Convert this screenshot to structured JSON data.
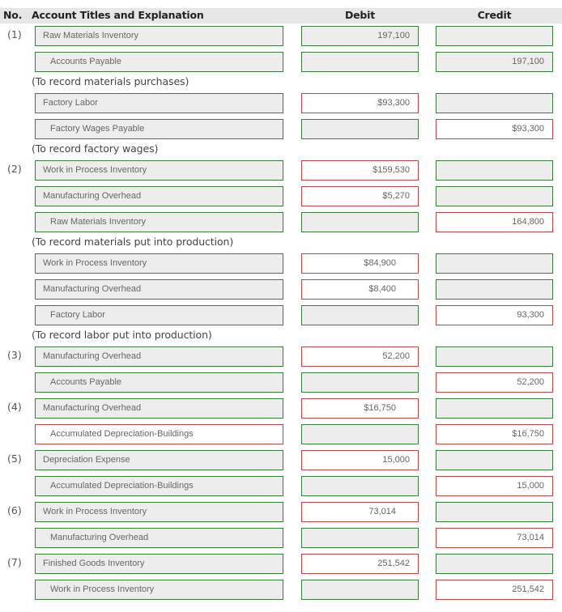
{
  "header": {
    "no": "No.",
    "account": "Account Titles and Explanation",
    "debit": "Debit",
    "credit": "Credit"
  },
  "status_colors": {
    "correct": "#3f7a3f",
    "incorrect": "#b04a4a"
  },
  "rows": [
    {
      "type": "line",
      "no": "(1)",
      "account": "Raw Materials Inventory",
      "indent": false,
      "account_status": "correct",
      "debit": "197,100",
      "debit_status": "correct",
      "credit": "",
      "credit_status": "correct"
    },
    {
      "type": "line",
      "no": "",
      "account": "Accounts Payable",
      "indent": true,
      "account_status": "correct",
      "debit": "",
      "debit_status": "correct",
      "credit": "197,100",
      "credit_status": "correct"
    },
    {
      "type": "explanation",
      "text": "(To record materials purchases)"
    },
    {
      "type": "line",
      "no": "",
      "account": "Factory Labor",
      "indent": false,
      "account_status": "correct",
      "debit": "$93,300",
      "debit_status": "incorrect",
      "credit": "",
      "credit_status": "correct"
    },
    {
      "type": "line",
      "no": "",
      "account": "Factory Wages Payable",
      "indent": true,
      "account_status": "correct",
      "debit": "",
      "debit_status": "correct",
      "credit": "$93,300",
      "credit_status": "incorrect"
    },
    {
      "type": "explanation",
      "text": "(To record factory wages)"
    },
    {
      "type": "line",
      "no": "(2)",
      "account": "Work in Process Inventory",
      "indent": false,
      "account_status": "correct",
      "debit": "$159,530",
      "debit_status": "incorrect",
      "credit": "",
      "credit_status": "correct"
    },
    {
      "type": "line",
      "no": "",
      "account": "Manufacturing Overhead",
      "indent": false,
      "account_status": "correct",
      "debit": "$5,270",
      "debit_status": "incorrect",
      "credit": "",
      "credit_status": "correct"
    },
    {
      "type": "line",
      "no": "",
      "account": "Raw Materials Inventory",
      "indent": true,
      "account_status": "correct",
      "debit": "",
      "debit_status": "correct",
      "credit": "164,800",
      "credit_status": "incorrect"
    },
    {
      "type": "explanation",
      "text": "(To record materials put into production)"
    },
    {
      "type": "line",
      "no": "",
      "account": "Work in Process Inventory",
      "indent": false,
      "account_status": "correct",
      "debit": "$84,900",
      "debit_status": "incorrect",
      "debit_mid": true,
      "credit": "",
      "credit_status": "correct"
    },
    {
      "type": "line",
      "no": "",
      "account": "Manufacturing Overhead",
      "indent": false,
      "account_status": "correct",
      "debit": "$8,400",
      "debit_status": "incorrect",
      "debit_mid": true,
      "credit": "",
      "credit_status": "correct"
    },
    {
      "type": "line",
      "no": "",
      "account": "Factory Labor",
      "indent": true,
      "account_status": "correct",
      "debit": "",
      "debit_status": "correct",
      "credit": "93,300",
      "credit_status": "incorrect"
    },
    {
      "type": "explanation",
      "text": "(To record labor put into production)"
    },
    {
      "type": "line",
      "no": "(3)",
      "account": "Manufacturing Overhead",
      "indent": false,
      "account_status": "correct",
      "debit": "52,200",
      "debit_status": "incorrect",
      "credit": "",
      "credit_status": "correct"
    },
    {
      "type": "line",
      "no": "",
      "account": "Accounts Payable",
      "indent": true,
      "account_status": "correct",
      "debit": "",
      "debit_status": "correct",
      "credit": "52,200",
      "credit_status": "incorrect"
    },
    {
      "type": "line",
      "no": "(4)",
      "account": "Manufacturing Overhead",
      "indent": false,
      "account_status": "correct",
      "debit": "$16,750",
      "debit_status": "incorrect",
      "debit_mid": true,
      "credit": "",
      "credit_status": "correct"
    },
    {
      "type": "line",
      "no": "",
      "account": "Accumulated Depreciation-Buildings",
      "indent": true,
      "account_status": "incorrect",
      "debit": "",
      "debit_status": "correct",
      "credit": "$16,750",
      "credit_status": "incorrect"
    },
    {
      "type": "line",
      "no": "(5)",
      "account": "Depreciation Expense",
      "indent": false,
      "account_status": "correct",
      "debit": "15,000",
      "debit_status": "incorrect",
      "credit": "",
      "credit_status": "correct"
    },
    {
      "type": "line",
      "no": "",
      "account": "Accumulated Depreciation-Buildings",
      "indent": true,
      "account_status": "correct",
      "debit": "",
      "debit_status": "correct",
      "credit": "15,000",
      "credit_status": "incorrect"
    },
    {
      "type": "line",
      "no": "(6)",
      "account": "Work in Process Inventory",
      "indent": false,
      "account_status": "correct",
      "debit": "73,014",
      "debit_status": "incorrect",
      "debit_mid": true,
      "credit": "",
      "credit_status": "correct"
    },
    {
      "type": "line",
      "no": "",
      "account": "Manufacturing Overhead",
      "indent": true,
      "account_status": "correct",
      "debit": "",
      "debit_status": "correct",
      "credit": "73,014",
      "credit_status": "incorrect"
    },
    {
      "type": "line",
      "no": "(7)",
      "account": "Finished Goods Inventory",
      "indent": false,
      "account_status": "correct",
      "debit": "251,542",
      "debit_status": "incorrect",
      "credit": "",
      "credit_status": "correct"
    },
    {
      "type": "line",
      "no": "",
      "account": "Work in Process Inventory",
      "indent": true,
      "account_status": "correct",
      "debit": "",
      "debit_status": "correct",
      "credit": "251,542",
      "credit_status": "incorrect"
    }
  ]
}
